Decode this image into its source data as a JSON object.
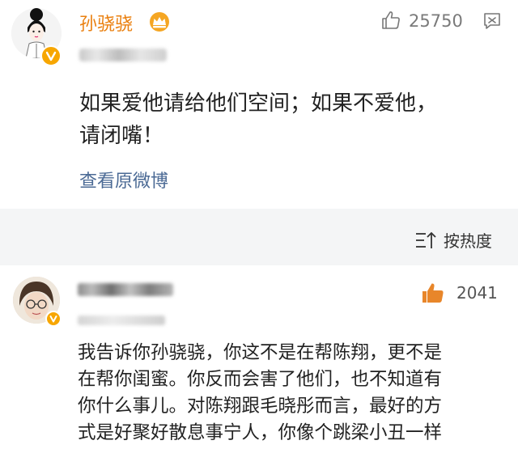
{
  "post": {
    "author": "孙骁骁",
    "like_count": "25750",
    "text_lines": [
      "如果爱他请给他们空间；如果不爱他，",
      "请闭嘴！"
    ],
    "view_original": "查看原微博"
  },
  "sort": {
    "label": "按热度"
  },
  "comment": {
    "like_count": "2041",
    "text_lines": [
      "我告诉你孙骁骁，你这不是在帮陈翔，更不是",
      "在帮你闺蜜。你反而会害了他们，也不知道有",
      "你什么事儿。对陈翔跟毛晓彤而言，最好的方",
      "式是好聚好散息事宁人，你像个跳梁小丑一样"
    ]
  },
  "colors": {
    "author_name": "#ea8010",
    "link": "#4b6a95",
    "verified_badge": "#f7a600",
    "like_icon_active": "#e8862a"
  },
  "icons": {
    "post_like": "thumbs-up-outline-icon",
    "comment": "comment-bubble-icon",
    "sort": "sort-icon",
    "comment_like": "thumbs-up-filled-icon",
    "vip": "crown-icon"
  }
}
